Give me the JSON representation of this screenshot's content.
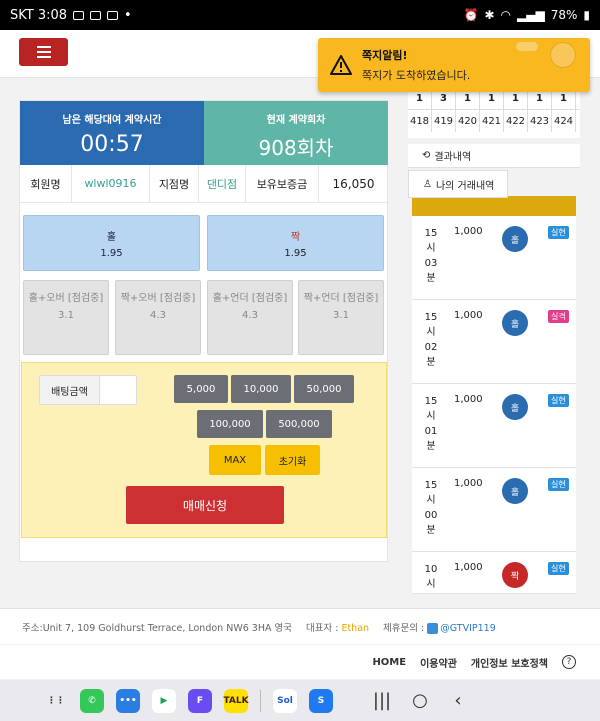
{
  "status": {
    "time": "SKT 3:08",
    "battery": "78%"
  },
  "notification": {
    "title": "쪽지알림!",
    "message": "쪽지가 도착하였습니다."
  },
  "timer": {
    "label": "남은 해당대여 계약시간",
    "value": "00:57"
  },
  "round": {
    "label": "현재 계약회차",
    "value": "908회차"
  },
  "info": {
    "member_label": "회원명",
    "member_value": "wlwl0916",
    "branch_label": "지점명",
    "branch_value": "댄디점",
    "deposit_label": "보유보증금",
    "deposit_value": "16,050"
  },
  "bets": {
    "hol": {
      "name": "홀",
      "odds": "1.95"
    },
    "jjak": {
      "name": "짝",
      "odds": "1.95"
    },
    "combos": [
      {
        "name": "홀+오버 [점검중]",
        "odds": "3.1"
      },
      {
        "name": "짝+오버 [점검중]",
        "odds": "4.3"
      },
      {
        "name": "홀+언더 [점검중]",
        "odds": "4.3"
      },
      {
        "name": "짝+언더 [점검중]",
        "odds": "3.1"
      }
    ]
  },
  "betting": {
    "amount_label": "배팅금액",
    "amount_value": "",
    "amounts": [
      "5,000",
      "10,000",
      "50,000",
      "100,000",
      "500,000"
    ],
    "max_label": "MAX",
    "reset_label": "초기화",
    "submit_label": "매매신청"
  },
  "history": {
    "results": [
      "1",
      "3",
      "1",
      "1",
      "1",
      "1",
      "1"
    ],
    "rounds": [
      "418",
      "419",
      "420",
      "421",
      "422",
      "423",
      "424"
    ],
    "tab_results": "결과내역",
    "tab_my": "나의 거래내역"
  },
  "orders": [
    {
      "time": "15시03분",
      "amount": "1,000",
      "pick": "홀",
      "result": "실현",
      "pick_color": "#2b6cb0",
      "result_color": "#2b8fdc"
    },
    {
      "time": "15시02분",
      "amount": "1,000",
      "pick": "홀",
      "result": "실격",
      "pick_color": "#2b6cb0",
      "result_color": "#e23d8b"
    },
    {
      "time": "15시01분",
      "amount": "1,000",
      "pick": "홀",
      "result": "실현",
      "pick_color": "#2b6cb0",
      "result_color": "#2b8fdc"
    },
    {
      "time": "15시00분",
      "amount": "1,000",
      "pick": "홀",
      "result": "실현",
      "pick_color": "#2b6cb0",
      "result_color": "#2b8fdc"
    },
    {
      "time": "10시",
      "amount": "1,000",
      "pick": "짝",
      "result": "실현",
      "pick_color": "#c62828",
      "result_color": "#2b8fdc"
    }
  ],
  "footer": {
    "address_prefix": "주소:",
    "address": "Unit 7, 109 Goldhurst Terrace, London NW6 3HA 영국",
    "ceo_label": "대표자 :",
    "ceo": "Ethan",
    "contact_label": "제휴문의 :",
    "contact": "@GTVIP119",
    "links": [
      "HOME",
      "이용약관",
      "개인정보 보호정책"
    ],
    "help": "?"
  },
  "apps": [
    {
      "icon": "apps-grid-icon",
      "label": "⋮⋮",
      "color": "#e9e9ee",
      "text": "#333"
    },
    {
      "icon": "phone-icon",
      "label": "✆",
      "color": "#34c759",
      "text": "#fff"
    },
    {
      "icon": "chat-icon",
      "label": "•••",
      "color": "#2a7de1",
      "text": "#fff"
    },
    {
      "icon": "play-store-icon",
      "label": "▶",
      "color": "#ffffff",
      "text": "#1aa260"
    },
    {
      "icon": "f-app-icon",
      "label": "F",
      "color": "#6a4cf0",
      "text": "#fff"
    },
    {
      "icon": "kakaotalk-icon",
      "label": "TALK",
      "color": "#ffe000",
      "text": "#3c1e1e"
    },
    {
      "icon": "sol-icon",
      "label": "Sol",
      "color": "#ffffff",
      "text": "#1f5bd4"
    },
    {
      "icon": "toss-icon",
      "label": "S",
      "color": "#1f7aef",
      "text": "#fff"
    }
  ]
}
